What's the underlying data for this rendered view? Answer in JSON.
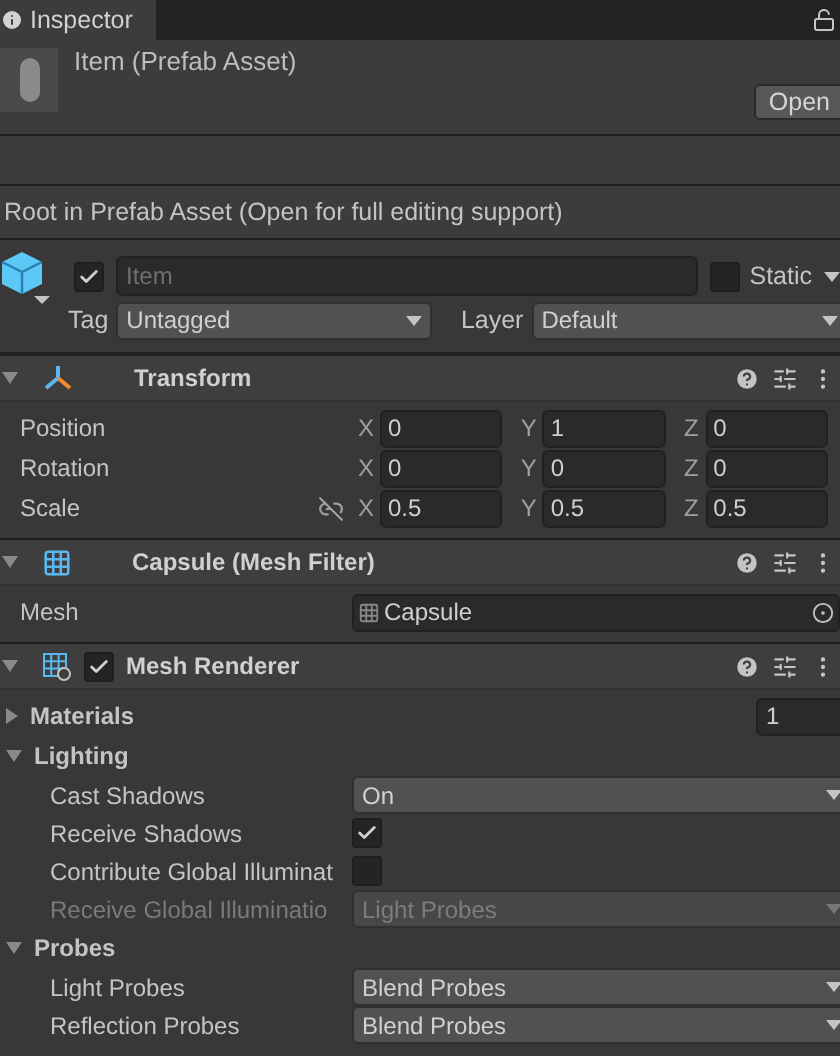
{
  "tab": {
    "title": "Inspector",
    "selected": true
  },
  "asset": {
    "title": "Item (Prefab Asset)",
    "open_button": "Open"
  },
  "notice": "Root in Prefab Asset (Open for full editing support)",
  "game_object": {
    "active": true,
    "name": "Item",
    "name_disabled": true,
    "static": {
      "label": "Static",
      "checked": false
    },
    "tag": {
      "label": "Tag",
      "value": "Untagged"
    },
    "layer": {
      "label": "Layer",
      "value": "Default"
    }
  },
  "components": [
    {
      "kind": "transform",
      "title": "Transform",
      "expanded": true,
      "rows": [
        {
          "kind": "vector",
          "label": "Position",
          "constrain_icon": false,
          "values": [
            {
              "axis": "X",
              "value": "0"
            },
            {
              "axis": "Y",
              "value": "1"
            },
            {
              "axis": "Z",
              "value": "0"
            }
          ]
        },
        {
          "kind": "vector",
          "label": "Rotation",
          "constrain_icon": false,
          "values": [
            {
              "axis": "X",
              "value": "0"
            },
            {
              "axis": "Y",
              "value": "0"
            },
            {
              "axis": "Z",
              "value": "0"
            }
          ]
        },
        {
          "kind": "vector",
          "label": "Scale",
          "constrain_icon": true,
          "values": [
            {
              "axis": "X",
              "value": "0.5"
            },
            {
              "axis": "Y",
              "value": "0.5"
            },
            {
              "axis": "Z",
              "value": "0.5"
            }
          ]
        }
      ]
    },
    {
      "kind": "mesh_filter",
      "title": "Capsule (Mesh Filter)",
      "expanded": true,
      "rows": [
        {
          "kind": "object",
          "label": "Mesh",
          "value": "Capsule"
        }
      ]
    },
    {
      "kind": "mesh_renderer",
      "title": "Mesh Renderer",
      "expanded": true,
      "enabled": true,
      "rows": [
        {
          "kind": "foldout",
          "label": "Materials",
          "expanded": false,
          "count": "1"
        },
        {
          "kind": "foldout",
          "label": "Lighting",
          "expanded": true,
          "children": [
            {
              "kind": "dropdown",
              "label": "Cast Shadows",
              "value": "On",
              "disabled": false
            },
            {
              "kind": "checkbox",
              "label": "Receive Shadows",
              "checked": true
            },
            {
              "kind": "checkbox",
              "label": "Contribute Global Illuminat",
              "checked": false
            },
            {
              "kind": "dropdown",
              "label": "Receive Global Illuminatio",
              "value": "Light Probes",
              "disabled": true
            }
          ]
        },
        {
          "kind": "foldout",
          "label": "Probes",
          "expanded": true,
          "children": [
            {
              "kind": "dropdown",
              "label": "Light Probes",
              "value": "Blend Probes",
              "disabled": false
            },
            {
              "kind": "dropdown",
              "label": "Reflection Probes",
              "value": "Blend Probes",
              "disabled": false
            }
          ]
        }
      ]
    }
  ]
}
